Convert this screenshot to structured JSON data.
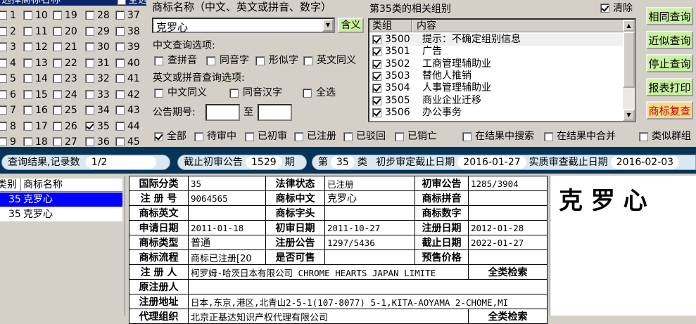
{
  "left_panel": {
    "header": "选择商标名称",
    "select_all": "全选",
    "columns": [
      [
        "1",
        "2",
        "3",
        "4",
        "5",
        "6",
        "7",
        "8",
        "9"
      ],
      [
        "10",
        "11",
        "12",
        "13",
        "14",
        "15",
        "16",
        "17",
        "18"
      ],
      [
        "19",
        "20",
        "21",
        "22",
        "23",
        "24",
        "25",
        "26",
        "27"
      ],
      [
        "28",
        "29",
        "30",
        "31",
        "32",
        "33",
        "34",
        "35",
        "36"
      ],
      [
        "37",
        "38",
        "39",
        "40",
        "41",
        "42",
        "43",
        "44",
        "45"
      ]
    ],
    "checked": [
      "35"
    ]
  },
  "name_input": {
    "label": "商标名称（中文、英文或拼音、数字）",
    "value": "克罗心",
    "synonym_button": "含义"
  },
  "cn_options": {
    "label": "中文查询选项:",
    "items": [
      "查拼音",
      "同音字",
      "形似字",
      "英文同义"
    ]
  },
  "en_options": {
    "label": "英文或拼音查询选项:",
    "items": [
      "中文同义",
      "同音汉字",
      "全选"
    ]
  },
  "announce": {
    "label": "公告期号:",
    "to": "至",
    "from_value": "",
    "to_value": ""
  },
  "groups": {
    "title": "第35类的相关组别",
    "clear_label": "清除",
    "col_group": "类组",
    "col_content": "内容",
    "rows": [
      {
        "code": "3500",
        "text": "提示：不确定组别信息"
      },
      {
        "code": "3501",
        "text": "广告"
      },
      {
        "code": "3502",
        "text": "工商管理辅助业"
      },
      {
        "code": "3503",
        "text": "替他人推销"
      },
      {
        "code": "3504",
        "text": "人事管理辅助业"
      },
      {
        "code": "3505",
        "text": "商业企业迁移"
      },
      {
        "code": "3506",
        "text": "办公事务"
      }
    ]
  },
  "buttons": [
    "相同查询",
    "近似查询",
    "停止查询",
    "报表打印",
    "商标复查"
  ],
  "status_filters": [
    "全部",
    "待审中",
    "已初审",
    "已注册",
    "已驳回",
    "已销亡",
    "在结果中搜索",
    "在结果中合并",
    "类似群组"
  ],
  "status_bar": {
    "result_label": "查询结果,记录数",
    "result_value": "1/2",
    "cutoff_label": "截止初审公告",
    "cutoff_value": "1529",
    "cutoff_unit": "期",
    "class_prefix": "第",
    "class_value": "35",
    "class_suffix": "类",
    "prelim_label": "初步审定截止日期",
    "prelim_value": "2016-01-27",
    "substantive_label": "实质审查截止日期",
    "substantive_value": "2016-02-03"
  },
  "result_list": {
    "col_class": "类别",
    "col_name": "商标名称",
    "rows": [
      {
        "cls": "35",
        "name": "克罗心",
        "selected": true
      },
      {
        "cls": "35",
        "name": "克罗心",
        "selected": false
      }
    ]
  },
  "detail": {
    "class_label": "国际分类",
    "class_value": "35",
    "legal_label": "法律状态",
    "legal_value": "已注册",
    "prelim_label": "初审公告",
    "prelim_value": "1285/3904",
    "reg_no_label": "注 册 号",
    "reg_no_value": "9064565",
    "cn_label": "商标中文",
    "cn_value": "克罗心",
    "pinyin_label": "商标拼音",
    "pinyin_value": "",
    "en_label": "商标英文",
    "en_value": "",
    "head_label": "商标字头",
    "head_value": "",
    "num_label": "商标数字",
    "num_value": "",
    "apply_label": "申请日期",
    "apply_value": "2011-01-18",
    "prelim_date_label": "初审日期",
    "prelim_date_value": "2011-10-27",
    "reg_date_label": "注册日期",
    "reg_date_value": "2012-01-28",
    "type_label": "商标类型",
    "type_value": "普通",
    "reg_ann_label": "注册公告",
    "reg_ann_value": "1297/5436",
    "expire_label": "截止日期",
    "expire_value": "2022-01-27",
    "flow_label": "商标流程",
    "flow_value": "商标已注册[20",
    "sellable_label": "是否可售",
    "sellable_value": "",
    "price_label": "预售价格",
    "price_value": "",
    "registrant_label": "注 册 人",
    "registrant_value": "柯罗姆-哈茨日本有限公司 CHROME HEARTS JAPAN LIMITE",
    "full_search": "全类检索",
    "orig_label": "原注册人",
    "orig_value": "",
    "addr_label": "注册地址",
    "addr_value": "日本,东京,港区,北青山2-5-1(107-8077) 5-1,KITA-AOYAMA 2-CHOME,MI",
    "agent_label": "代理组织",
    "agent_value": "北京正基达知识产权代理有限公司",
    "agent_search": "全类检索"
  },
  "preview_name": "克 罗 心"
}
